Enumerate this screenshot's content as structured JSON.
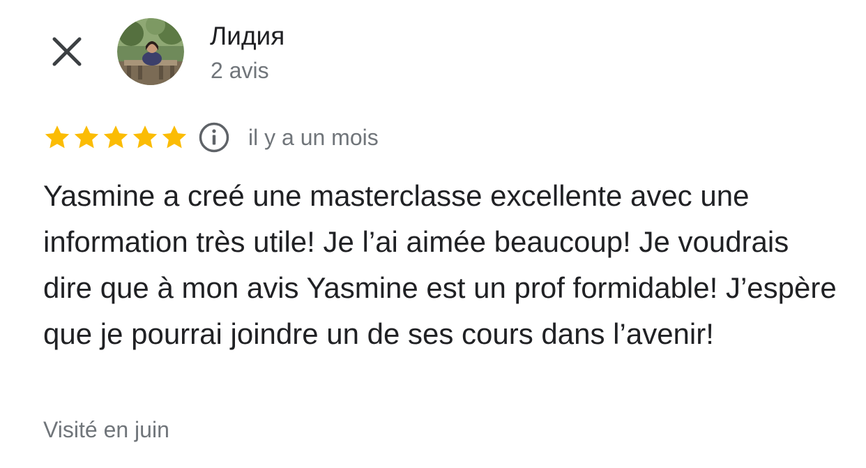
{
  "header": {
    "close_icon": "close-icon",
    "author": {
      "name": "Лидия",
      "review_count": "2 avis",
      "avatar": "user-photo"
    }
  },
  "review": {
    "rating": 5,
    "rating_max": 5,
    "star_color": "#fbbc04",
    "info_icon": "info-icon",
    "date": "il y a un mois",
    "text": "Yasmine a creé une masterclasse excellente avec une information très utile! Je l’ai aimée beaucoup! Je voudrais dire que à mon avis Yasmine est un prof formidable! J’espère que je pourrai joindre un de ses cours dans l’avenir!",
    "visit_note": "Visité en juin"
  }
}
